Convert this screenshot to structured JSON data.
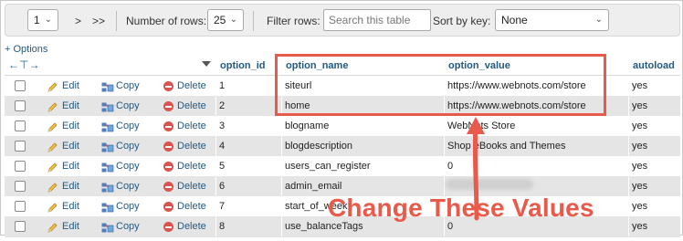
{
  "navigation": {
    "page_select": "1",
    "next_label": ">",
    "last_label": ">>",
    "rows_label": "Number of rows:",
    "rows_value": "25",
    "filter_label": "Filter rows:",
    "filter_placeholder": "Search this table",
    "sort_label": "Sort by key:",
    "sort_value": "None"
  },
  "options_link": "+ Options",
  "columns": {
    "option_id": "option_id",
    "option_name": "option_name",
    "option_value": "option_value",
    "autoload": "autoload"
  },
  "actions": {
    "edit": "Edit",
    "copy": "Copy",
    "delete": "Delete"
  },
  "rows": [
    {
      "option_id": "1",
      "option_name": "siteurl",
      "option_value": "https://www.webnots.com/store",
      "autoload": "yes"
    },
    {
      "option_id": "2",
      "option_name": "home",
      "option_value": "https://www.webnots.com/store",
      "autoload": "yes"
    },
    {
      "option_id": "3",
      "option_name": "blogname",
      "option_value": "WebNots Store",
      "autoload": "yes"
    },
    {
      "option_id": "4",
      "option_name": "blogdescription",
      "option_value": "Shop eBooks and Themes",
      "autoload": "yes"
    },
    {
      "option_id": "5",
      "option_name": "users_can_register",
      "option_value": "0",
      "autoload": "yes"
    },
    {
      "option_id": "6",
      "option_name": "admin_email",
      "option_value": "",
      "autoload": "yes"
    },
    {
      "option_id": "7",
      "option_name": "start_of_week",
      "option_value": "",
      "autoload": "yes"
    },
    {
      "option_id": "8",
      "option_name": "use_balanceTags",
      "option_value": "0",
      "autoload": "yes"
    }
  ],
  "annotation": {
    "text": "Change These Values",
    "color": "#ea5a4b"
  },
  "colors": {
    "link": "#235a81",
    "row_alt": "#e5e5e5",
    "toolbar": "#eeeeee"
  }
}
